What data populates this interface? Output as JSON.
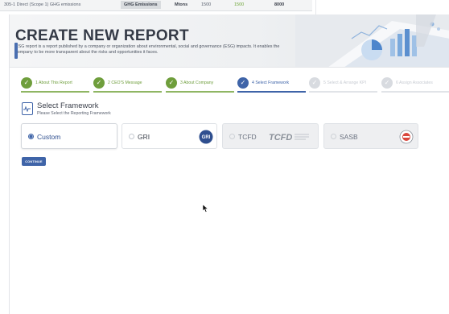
{
  "background_table": {
    "row_label": "305-1 Direct (Scope 1) GHG emissions",
    "category": "GHG Emissions",
    "unit": "Mtons",
    "value_a": "1500",
    "value_b": "1500",
    "value_c": "8000"
  },
  "banner": {
    "title": "CREATE NEW REPORT",
    "description": "ESG report is a report published by a company or organization about environmental, social and governance (ESG) impacts. It enables the company to be more transparent about the risks and opportunities it faces."
  },
  "steps": [
    {
      "label": "1 About This Report",
      "state": "done"
    },
    {
      "label": "2 CEO'S Message",
      "state": "done"
    },
    {
      "label": "3 About Company",
      "state": "done"
    },
    {
      "label": "4 Select Framework",
      "state": "active"
    },
    {
      "label": "5 Select & Arrange KPI",
      "state": "pending"
    },
    {
      "label": "6 Assign Associates",
      "state": "pending"
    }
  ],
  "section": {
    "title": "Select Framework",
    "subtitle": "Please Select the Reporting Framework"
  },
  "frameworks": [
    {
      "name": "Custom",
      "selected": true,
      "enabled": true
    },
    {
      "name": "GRI",
      "selected": false,
      "enabled": true,
      "logo": "GRI"
    },
    {
      "name": "TCFD",
      "selected": false,
      "enabled": false,
      "logo": "TCFD"
    },
    {
      "name": "SASB",
      "selected": false,
      "enabled": false
    }
  ],
  "continue_label": "CONTINUE",
  "colors": {
    "accent": "#3f64a8",
    "done_green": "#6f9e3c",
    "pending_gray": "#d8dbe0",
    "title_text": "#343a46"
  }
}
